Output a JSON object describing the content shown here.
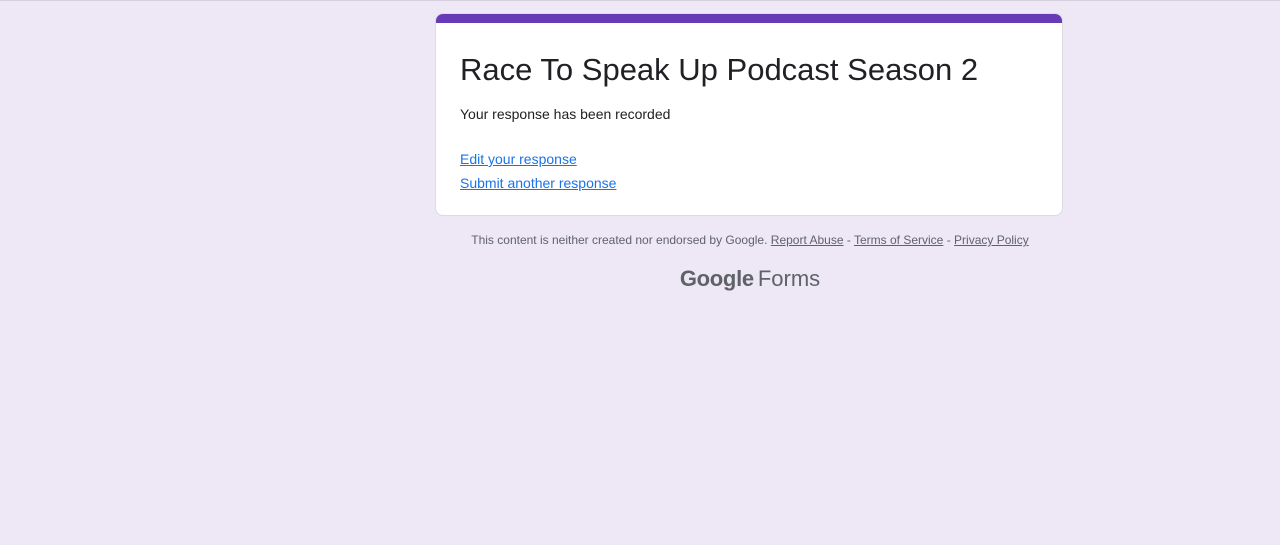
{
  "form": {
    "title": "Race To Speak Up Podcast Season 2",
    "confirmation_message": "Your response has been recorded",
    "edit_link": "Edit your response",
    "submit_another_link": "Submit another response"
  },
  "footer": {
    "disclaimer": "This content is neither created nor endorsed by Google.",
    "report_abuse": "Report Abuse",
    "separator": "-",
    "terms": "Terms of Service",
    "privacy": "Privacy Policy"
  },
  "brand": {
    "google": "Google",
    "forms": "Forms"
  },
  "colors": {
    "background": "#ede7f6",
    "accent": "#673ab7",
    "link": "#1a73e8"
  }
}
